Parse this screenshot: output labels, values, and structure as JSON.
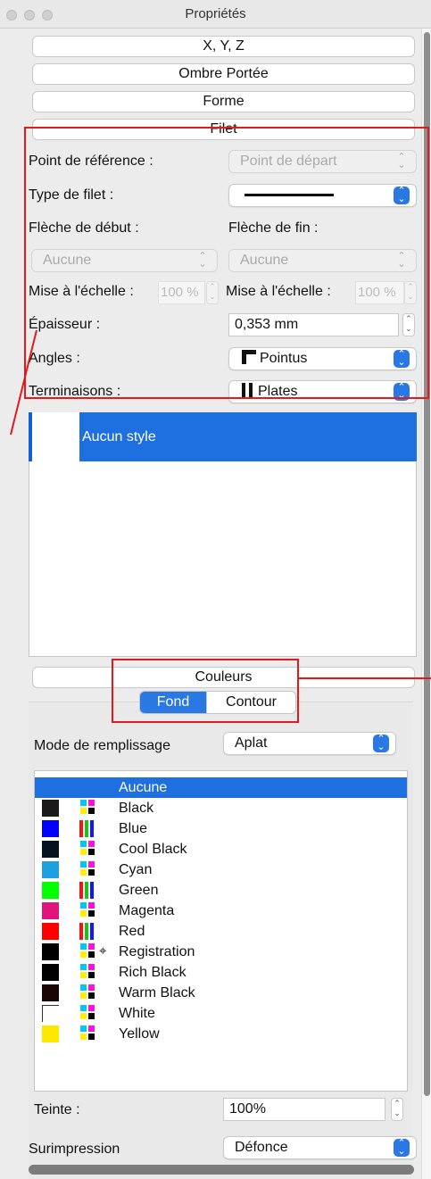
{
  "window": {
    "title": "Propriétés"
  },
  "sections": {
    "xyz": "X, Y, Z",
    "shadow": "Ombre Portée",
    "shape": "Forme",
    "stroke": "Filet",
    "colors": "Couleurs"
  },
  "stroke": {
    "ref_point_label": "Point de référence :",
    "ref_point_value": "Point de départ",
    "type_label": "Type de filet :",
    "start_arrow_label": "Flèche de début :",
    "end_arrow_label": "Flèche de fin :",
    "start_arrow_value": "Aucune",
    "end_arrow_value": "Aucune",
    "scale_label_left": "Mise à l'échelle :",
    "scale_value_left": "100 %",
    "scale_label_right": "Mise à l'échelle :",
    "scale_value_right": "100 %",
    "thickness_label": "Épaisseur :",
    "thickness_value": "0,353 mm",
    "corners_label": "Angles :",
    "corners_value": "Pointus",
    "caps_label": "Terminaisons :",
    "caps_value": "Plates"
  },
  "styles": {
    "selected": "Aucun style"
  },
  "colors": {
    "tab_fill": "Fond",
    "tab_stroke": "Contour",
    "fill_mode_label": "Mode de remplissage",
    "fill_mode_value": "Aplat",
    "items": [
      {
        "name": "Aucune",
        "swatch": "none",
        "kind": "none",
        "selected": true
      },
      {
        "name": "Black",
        "swatch": "#1a1a1a",
        "kind": "cmyk"
      },
      {
        "name": "Blue",
        "swatch": "#0000ff",
        "kind": "spot"
      },
      {
        "name": "Cool Black",
        "swatch": "#06121f",
        "kind": "cmyk"
      },
      {
        "name": "Cyan",
        "swatch": "#1ea0e0",
        "kind": "cmyk"
      },
      {
        "name": "Green",
        "swatch": "#00ff00",
        "kind": "spot"
      },
      {
        "name": "Magenta",
        "swatch": "#e0137f",
        "kind": "cmyk"
      },
      {
        "name": "Red",
        "swatch": "#ff0000",
        "kind": "spot"
      },
      {
        "name": "Registration",
        "swatch": "#000000",
        "kind": "registration"
      },
      {
        "name": "Rich Black",
        "swatch": "#000000",
        "kind": "cmyk"
      },
      {
        "name": "Warm Black",
        "swatch": "#1c0605",
        "kind": "cmyk"
      },
      {
        "name": "White",
        "swatch": "#ffffff",
        "kind": "cmyk"
      },
      {
        "name": "Yellow",
        "swatch": "#ffe800",
        "kind": "cmyk"
      }
    ],
    "tint_label": "Teinte :",
    "tint_value": "100%",
    "overprint_label": "Surimpression",
    "overprint_value": "Défonce"
  }
}
